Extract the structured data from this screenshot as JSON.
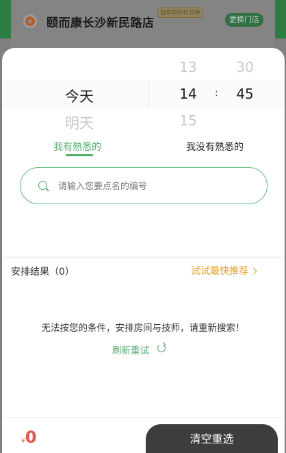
{
  "store": {
    "name": "颐而康长沙新民路店",
    "tag": "自驾车约41分钟",
    "change_label": "更换门店"
  },
  "picker": {
    "day_active": "今天",
    "day_next": "明天",
    "hour_prev": "13",
    "hour_active": "14",
    "hour_next": "15",
    "minute_prev": "30",
    "minute_active": "45",
    "separator": ":"
  },
  "tabs": {
    "active": "我有熟悉的",
    "other": "我没有熟悉的"
  },
  "search": {
    "placeholder": "请输入您要点名的编号",
    "value": ""
  },
  "results": {
    "title": "安排结果（0）",
    "recommend_label": "试试最快推荐",
    "empty_message": "无法按您的条件，安排房间与技师，请重新搜索！",
    "retry_label": "刷新重试"
  },
  "footer": {
    "currency": "¥",
    "amount": "0",
    "reset_label": "清空重选"
  },
  "colors": {
    "accent_green": "#4caf6c",
    "accent_orange": "#f0a11a",
    "price_red": "#f0504a",
    "button_dark": "#3d3d3d"
  }
}
